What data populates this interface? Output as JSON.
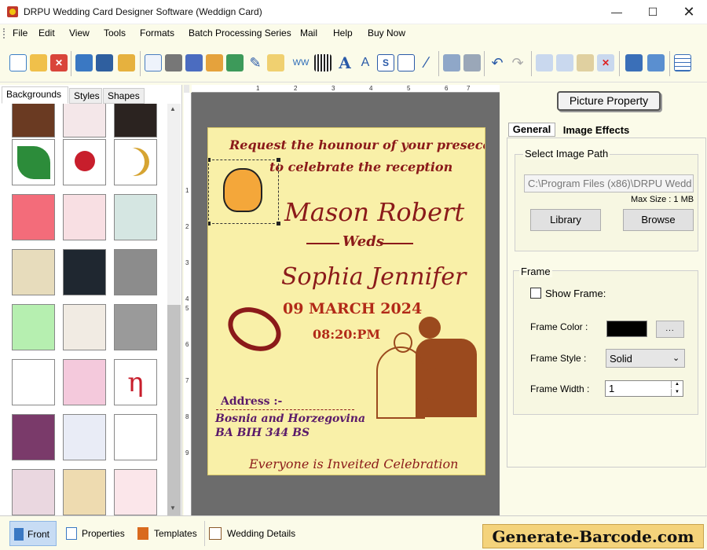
{
  "window": {
    "title": "DRPU Wedding Card Designer Software (Weddign Card)"
  },
  "menu": [
    "File",
    "Edit",
    "View",
    "Tools",
    "Formats",
    "Batch Processing Series",
    "Mail",
    "Help",
    "Buy Now"
  ],
  "left_tabs": [
    "Backgrounds",
    "Styles",
    "Shapes"
  ],
  "right": {
    "title": "Picture Property",
    "tabs": [
      "General",
      "Image Effects"
    ],
    "image_path_label": "Select Image Path",
    "image_path_value": "C:\\Program Files (x86)\\DRPU Wedd",
    "max_size": "Max Size : 1 MB",
    "library": "Library",
    "browse": "Browse",
    "frame_label": "Frame",
    "show_frame": "Show Frame:",
    "frame_color_label": "Frame Color :",
    "dots": "...",
    "frame_style_label": "Frame Style :",
    "frame_style_value": "Solid",
    "frame_width_label": "Frame Width :",
    "frame_width_value": "1"
  },
  "card": {
    "line1": "Request the hounour of your presece",
    "line2": "to celebrate the reception",
    "groom": "Mason Robert",
    "weds": "Weds",
    "bride": "Sophia Jennifer",
    "date": "09 MARCH 2024",
    "time": "08:20:PM",
    "address_label": "Address :-",
    "address1": "Bosnia and Horzegovina",
    "address2": "BA BIH 344 BS",
    "footer": "Everyone is Inveited Celebration"
  },
  "bottom_tabs": [
    "Front",
    "Properties",
    "Templates",
    "Wedding Details"
  ],
  "brand": "Generate-Barcode.com",
  "ruler_h": [
    "1",
    "2",
    "3",
    "4",
    "5",
    "6",
    "7"
  ],
  "ruler_v": [
    "1",
    "2",
    "3",
    "4",
    "5",
    "6",
    "7",
    "8",
    "9"
  ]
}
